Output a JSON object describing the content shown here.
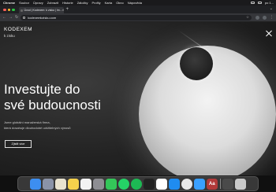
{
  "menubar": {
    "items": [
      "Chrome",
      "Soubor",
      "Úpravy",
      "Zobrazit",
      "Historie",
      "Záložky",
      "Profily",
      "Karta",
      "Okno",
      "Nápověda"
    ],
    "time": "po 1..."
  },
  "browser": {
    "tab_title": "Úvod | Kodexem: k zisku | Im...",
    "url": "kodexemkzisku.com"
  },
  "site": {
    "brand_name": "KODEXEM",
    "brand_sub": "k zisku",
    "headline_line1": "Investujte do",
    "headline_line2": "své budoucnosti",
    "tagline_line1": "Jsme globální manažerská firma,",
    "tagline_line2": "která dosahuje dlouhodobé udržitelných výnosů",
    "cta_label": "Zjistit více"
  },
  "dock": {
    "apps": [
      {
        "name": "finder-icon",
        "color": "#3d8ef0"
      },
      {
        "name": "launchpad-icon",
        "color": "#8a93a8"
      },
      {
        "name": "files-icon",
        "color": "#e9e3cf"
      },
      {
        "name": "notes-icon",
        "color": "#f5d14c"
      },
      {
        "name": "calendar-icon",
        "color": "#f3f3f3"
      },
      {
        "name": "settings-icon",
        "color": "#8e8e93"
      },
      {
        "name": "messages-icon",
        "color": "#34c759"
      },
      {
        "name": "whatsapp-icon",
        "color": "#25d366"
      },
      {
        "name": "spotify-icon",
        "color": "#1db954"
      },
      {
        "name": "capcut-icon",
        "color": "#222222"
      },
      {
        "name": "photos-icon",
        "color": "#ffffff"
      },
      {
        "name": "app-store-icon",
        "color": "#1f8cf0"
      },
      {
        "name": "chrome-icon",
        "color": "#e8e8e8"
      },
      {
        "name": "vpn-icon",
        "color": "#3aa0ff"
      },
      {
        "name": "dictionary-icon",
        "color": "#b23a3a"
      },
      {
        "name": "downloads-icon",
        "color": "#4a4a4a"
      },
      {
        "name": "trash-icon",
        "color": "#c9c9c9"
      }
    ],
    "dictionary_glyph": "Aa"
  },
  "colors": {
    "page_background": "#232323",
    "text": "#ffffff"
  }
}
